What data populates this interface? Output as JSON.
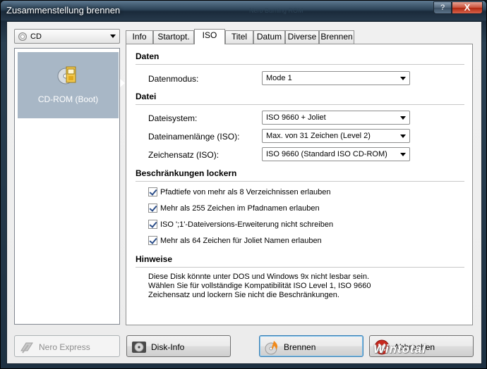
{
  "window": {
    "title": "Zusammenstellung brennen",
    "ghost_title": "Nero Burning ROM",
    "help_button": "?",
    "close_button": "X"
  },
  "left": {
    "media_combo": "CD",
    "tile_label": "CD-ROM (Boot)"
  },
  "tabs": [
    {
      "label": "Info"
    },
    {
      "label": "Startopt."
    },
    {
      "label": "ISO"
    },
    {
      "label": "Titel"
    },
    {
      "label": "Datum"
    },
    {
      "label": "Diverse"
    },
    {
      "label": "Brennen"
    }
  ],
  "active_tab": "ISO",
  "iso": {
    "daten_title": "Daten",
    "datenmodus_label": "Datenmodus:",
    "datenmodus_value": "Mode 1",
    "datei_title": "Datei",
    "dateisystem_label": "Dateisystem:",
    "dateisystem_value": "ISO 9660 + Joliet",
    "dateinamenlaenge_label": "Dateinamenlänge (ISO):",
    "dateinamenlaenge_value": "Max. von 31 Zeichen (Level 2)",
    "zeichensatz_label": "Zeichensatz (ISO):",
    "zeichensatz_value": "ISO 9660 (Standard ISO CD-ROM)",
    "restrictions_title": "Beschränkungen lockern",
    "checkboxes": [
      {
        "label": "Pfadtiefe von mehr als 8 Verzeichnissen erlauben",
        "checked": true
      },
      {
        "label": "Mehr als 255 Zeichen im Pfadnamen erlauben",
        "checked": true
      },
      {
        "label": "ISO ';1'-Dateiversions-Erweiterung nicht schreiben",
        "checked": true
      },
      {
        "label": "Mehr als 64 Zeichen für Joliet Namen erlauben",
        "checked": true
      }
    ],
    "hinweise_title": "Hinweise",
    "hint_lines": [
      "Diese Disk könnte unter DOS und Windows 9x nicht lesbar sein.",
      "Wählen Sie für vollständige Kompatibilität ISO Level 1, ISO 9660",
      "Zeichensatz und lockern Sie nicht die Beschränkungen."
    ]
  },
  "buttons": {
    "nero_express": "Nero Express",
    "disk_info": "Disk-Info",
    "brennen": "Brennen",
    "abbrechen": "Abbrechen"
  },
  "watermark": "Wintotal",
  "colors": {
    "tile_bg": "#a8b7c6",
    "check": "#2d4f8a",
    "cancel_icon": "#c8281e"
  }
}
